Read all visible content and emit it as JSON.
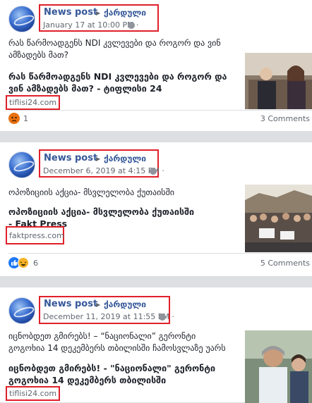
{
  "posts": [
    {
      "page_name": "News post",
      "destination": "ქარდული",
      "date": "January 17 at 10:00 PM · ",
      "message": "რას წარმოადგენს NDI კვლევები და როგორ და ვინ ამზადებს მათ?",
      "link_title": "რას წარმოადგენს NDI კვლევები და როგორ და ვინ ამზადებს მათ? - ტიფლისი 24",
      "domain": "tiflisi24.com",
      "reaction_count": "1",
      "comments": "3 Comments",
      "reactions": [
        "angry-reaction-icon"
      ]
    },
    {
      "page_name": "News post",
      "destination": "ქარდული",
      "date": "December 6, 2019 at 4:15 PM · ",
      "message": "ოპოზიციის აქცია- მსვლელობა ქუთაისში",
      "link_title": "ოპოზიციის აქცია- მსვლელობა ქუთაისში - Fakt Press",
      "domain": "faktpress.com",
      "reaction_count": "6",
      "comments": "5 Comments",
      "reactions": [
        "like-reaction-icon",
        "haha-reaction-icon"
      ]
    },
    {
      "page_name": "News post",
      "destination": "ქარდული",
      "date": "December 11, 2019 at 11:55 PM · ",
      "message": "იცნობდეთ გმირებს! – “ნაციონალი” გერონტი გოგოხია 14 დეკემბერს თბილისში ჩამოსვლაზე უარს აცხადებს",
      "link_title": "იცნობდეთ გმირებს! - \"ნაციონალი\" გერონტი გოგოხია 14 დეკემბერს თბილისში ჩამოსვლაზე...",
      "domain": "tiflisi24.com"
    }
  ],
  "colors": {
    "highlight_box": "#e0202a",
    "page_name": "#365899",
    "background": "#dddfe2"
  }
}
